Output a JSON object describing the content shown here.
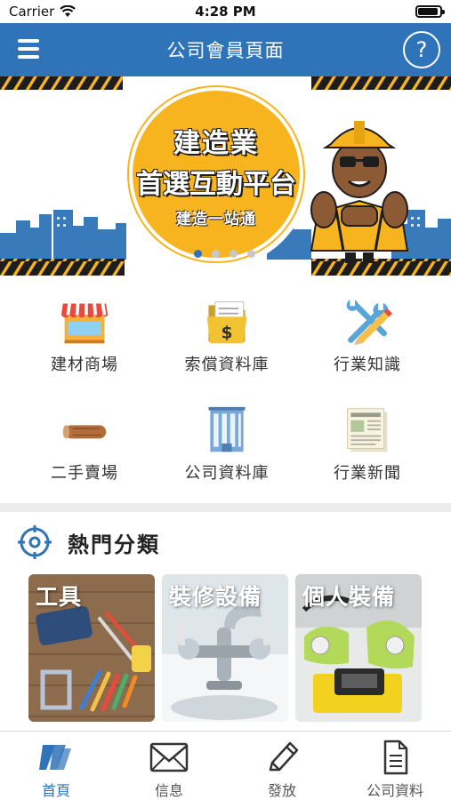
{
  "status_bar": {
    "carrier": "Carrier",
    "time": "4:28 PM",
    "battery_level": 0.9
  },
  "navbar": {
    "title": "公司會員頁面",
    "help_icon": "question-circle-icon",
    "menu_icon": "hamburger-menu-icon"
  },
  "banner": {
    "line1": "建造業",
    "line2": "首選互動平台",
    "line3": "建造一站通",
    "page_count": 4,
    "active_page": 0,
    "colors": {
      "yellow": "#f7b41f",
      "blue": "#2f73b8"
    }
  },
  "grid": [
    {
      "label": "建材商場",
      "icon": "shop-icon"
    },
    {
      "label": "索償資料庫",
      "icon": "claim-folder-icon"
    },
    {
      "label": "行業知識",
      "icon": "tools-pencil-icon"
    },
    {
      "label": "二手賣場",
      "icon": "timber-log-icon"
    },
    {
      "label": "公司資料庫",
      "icon": "building-icon"
    },
    {
      "label": "行業新聞",
      "icon": "newspaper-icon"
    }
  ],
  "hot": {
    "title": "熱門分類",
    "icon": "target-icon",
    "cards": [
      {
        "label": "工具"
      },
      {
        "label": "裝修設備"
      },
      {
        "label": "個人裝備"
      }
    ]
  },
  "tabbar": [
    {
      "label": "首頁",
      "icon": "home-logo-icon",
      "active": true
    },
    {
      "label": "信息",
      "icon": "envelope-icon",
      "active": false
    },
    {
      "label": "發放",
      "icon": "pencil-icon",
      "active": false
    },
    {
      "label": "公司資料",
      "icon": "document-icon",
      "active": false
    }
  ],
  "colors": {
    "primary": "#2f73b8",
    "separator": "#ececec"
  }
}
